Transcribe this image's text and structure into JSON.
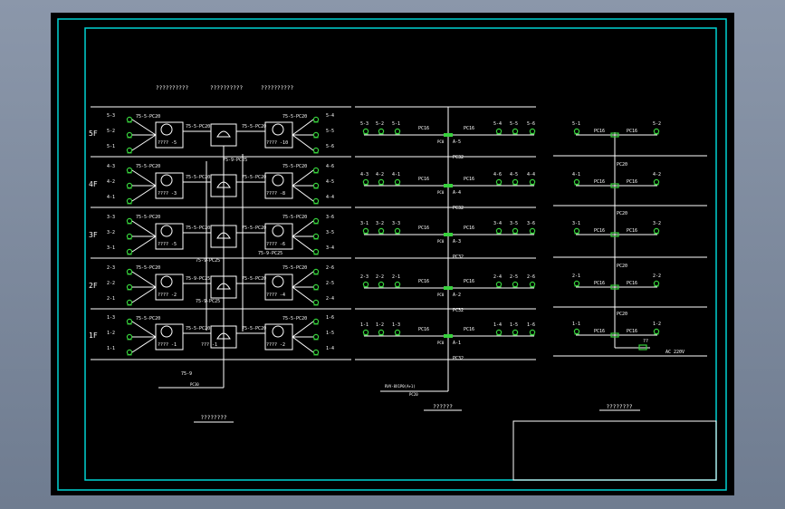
{
  "colors": {
    "background": "#000000",
    "frame": "#00d2d2",
    "line": "#ffffff",
    "device": "#37d23c",
    "text": "#ffffff",
    "workspace": "#7d8a9e"
  },
  "left_diagram": {
    "headers": [
      "??????????",
      "??????????",
      "??????????"
    ],
    "floors": [
      {
        "label": "5F",
        "left_ports": [
          "5-3",
          "5-2",
          "5-1"
        ],
        "right_ports": [
          "5-4",
          "5-5",
          "5-6"
        ],
        "cable_left": "75-5-PC20",
        "cable_mid_left": "75-5-PC20",
        "cable_mid_right": "75-5-PC20",
        "cable_right": "75-5-PC20",
        "box_left": "???? -5",
        "box_right": "???? -10",
        "splitter": "???? -1"
      },
      {
        "label": "4F",
        "left_ports": [
          "4-3",
          "4-2",
          "4-1"
        ],
        "right_ports": [
          "4-6",
          "4-5",
          "4-4"
        ],
        "cable_left": "75-5-PC20",
        "cable_mid_left": "75-5-PC20",
        "cable_mid_right": "75-5-PC20",
        "cable_right": "75-5-PC20",
        "box_left": "???? -3",
        "box_right": "???? -8",
        "splitter": "75-9-PC25"
      },
      {
        "label": "3F",
        "left_ports": [
          "3-3",
          "3-2",
          "3-1"
        ],
        "right_ports": [
          "3-6",
          "3-5",
          "3-4"
        ],
        "cable_left": "75-5-PC20",
        "cable_mid_left": "75-5-PC20",
        "cable_mid_right": "75-5-PC20",
        "cable_right": "75-5-PC20",
        "box_left": "???? -5",
        "box_right": "???? -6",
        "splitter": "75-9-PC25"
      },
      {
        "label": "2F",
        "left_ports": [
          "2-3",
          "2-2",
          "2-1"
        ],
        "right_ports": [
          "2-6",
          "2-5",
          "2-4"
        ],
        "cable_left": "75-5-PC20",
        "cable_mid_left": "75-9-PC25",
        "cable_mid_right": "75-5-PC20",
        "cable_right": "75-5-PC20",
        "box_left": "???? -2",
        "box_right": "???? -4",
        "splitter": "75-9-PC25"
      },
      {
        "label": "1F",
        "left_ports": [
          "1-3",
          "1-2",
          "1-1"
        ],
        "right_ports": [
          "1-6",
          "1-5",
          "1-4"
        ],
        "cable_left": "75-5-PC20",
        "cable_mid_left": "75-5-PC20",
        "cable_mid_right": "75-5-PC20",
        "cable_right": "75-5-PC20",
        "box_left": "???? -1",
        "box_right": "???? -2",
        "splitter": "??? -1"
      }
    ],
    "incoming_label": "75-9",
    "incoming_sub": "PC30",
    "caption": "????????"
  },
  "middle_diagram": {
    "floors": [
      {
        "labels": [
          "5-3",
          "5-2",
          "5-1",
          "5-4",
          "5-5",
          "5-6"
        ],
        "pipe_left": "PC16",
        "pipe_right": "PC16",
        "riser": "PC32",
        "node": "A-5",
        "node_sub": "PC0"
      },
      {
        "labels": [
          "4-3",
          "4-2",
          "4-1",
          "4-6",
          "4-5",
          "4-4"
        ],
        "pipe_left": "PC16",
        "pipe_right": "PC16",
        "riser": "PC32",
        "node": "A-4",
        "node_sub": "PC0"
      },
      {
        "labels": [
          "3-1",
          "3-2",
          "3-3",
          "3-4",
          "3-5",
          "3-6"
        ],
        "pipe_left": "PC16",
        "pipe_right": "PC16",
        "riser": "PC32",
        "node": "A-3",
        "node_sub": "PC0"
      },
      {
        "labels": [
          "2-3",
          "2-2",
          "2-1",
          "2-4",
          "2-5",
          "2-6"
        ],
        "pipe_left": "PC16",
        "pipe_right": "PC16",
        "riser": "PC32",
        "node": "A-2",
        "node_sub": "PC0"
      },
      {
        "labels": [
          "1-1",
          "1-2",
          "1-3",
          "1-4",
          "1-5",
          "1-6"
        ],
        "pipe_left": "PC16",
        "pipe_right": "PC16",
        "riser": "PC32",
        "node": "A-1",
        "node_sub": "PC0"
      }
    ],
    "incoming_label": "RVV-8X1P0(A+1)",
    "incoming_sub": "PC20",
    "caption": "??????"
  },
  "right_diagram": {
    "floors": [
      {
        "left": "5-1",
        "right": "5-2",
        "pipe_left": "PC16",
        "pipe_right": "PC16",
        "riser": "PC20"
      },
      {
        "left": "4-1",
        "right": "4-2",
        "pipe_left": "PC16",
        "pipe_right": "PC16",
        "riser": "PC20"
      },
      {
        "left": "3-1",
        "right": "3-2",
        "pipe_left": "PC16",
        "pipe_right": "PC16",
        "riser": "PC20"
      },
      {
        "left": "2-1",
        "right": "2-2",
        "pipe_left": "PC16",
        "pipe_right": "PC16",
        "riser": "PC20"
      },
      {
        "left": "1-1",
        "right": "1-2",
        "pipe_left": "PC16",
        "pipe_right": "PC16",
        "riser": "PC20"
      }
    ],
    "feed_label": "??",
    "feed_text": "AC 220V",
    "caption": "????????"
  }
}
